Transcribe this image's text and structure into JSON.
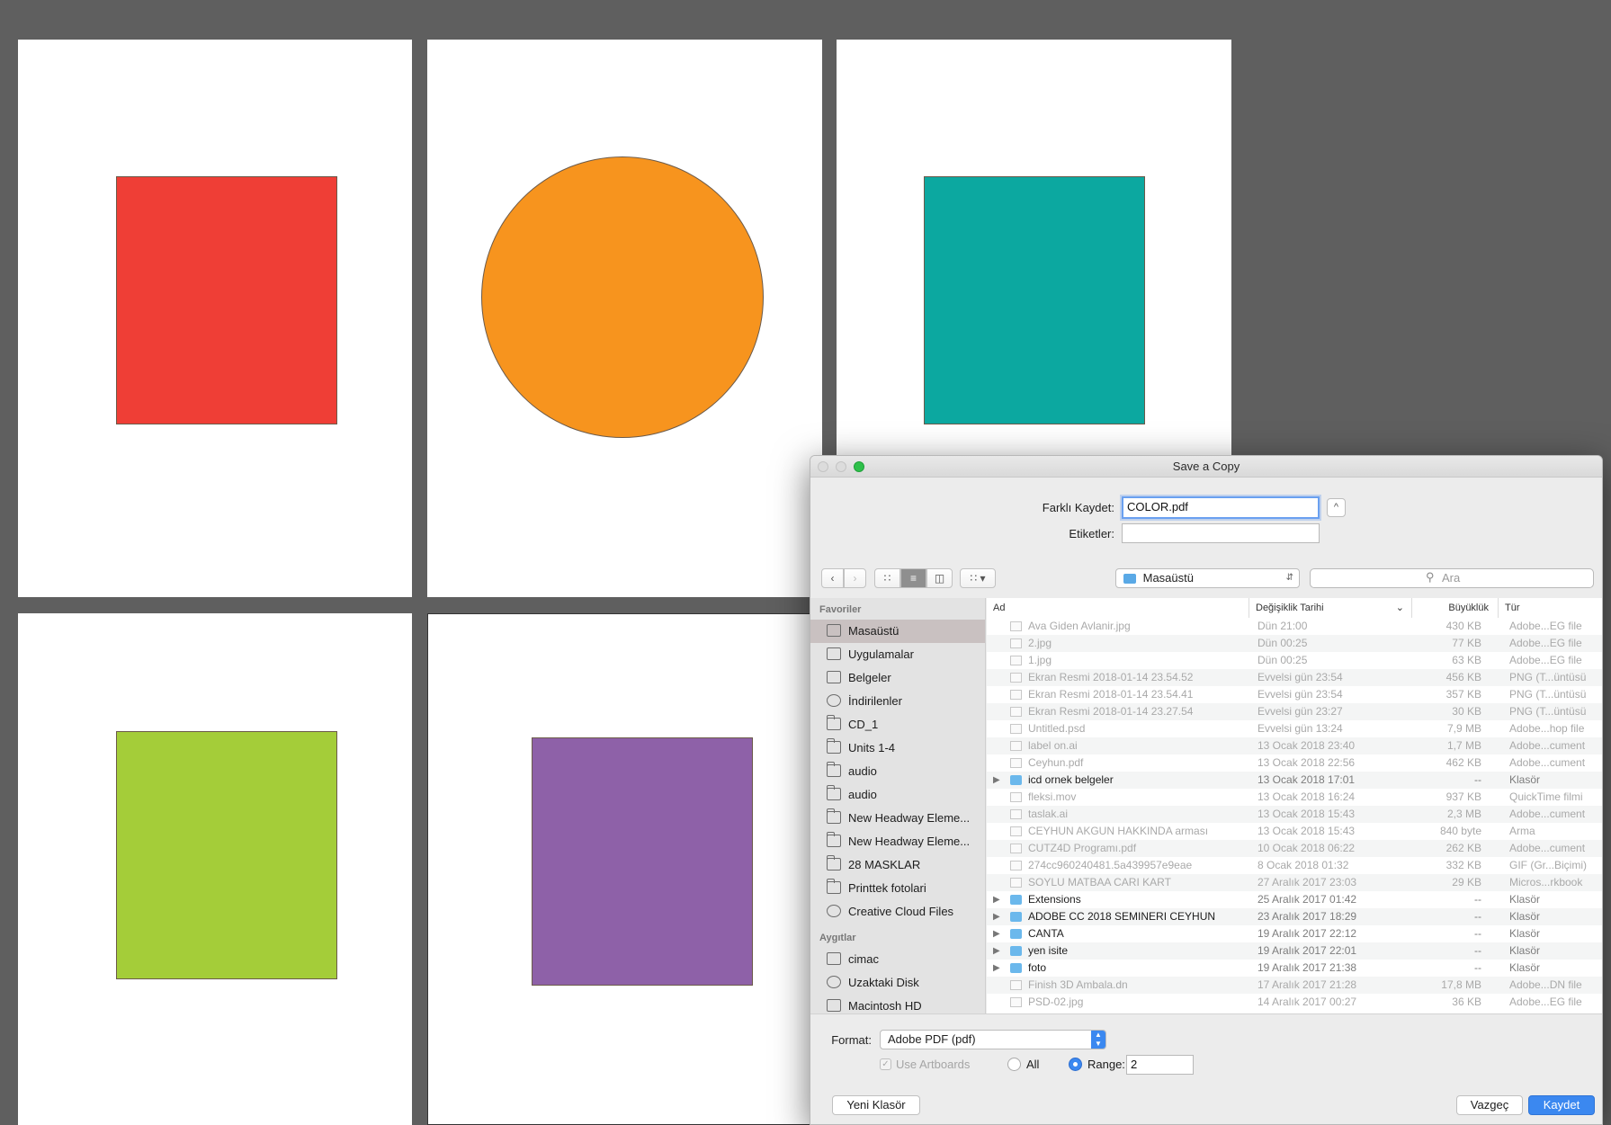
{
  "colors": {
    "red": "#ef3e36",
    "orange": "#f7941e",
    "teal": "#0ca8a0",
    "green": "#a4cd39",
    "purple": "#8e61a8",
    "accent": "#3b88f0"
  },
  "dialog": {
    "title": "Save a Copy",
    "save_as_label": "Farklı Kaydet:",
    "save_as_value": "COLOR.pdf",
    "tags_label": "Etiketler:",
    "location": "Masaüstü",
    "search_placeholder": "Ara",
    "expand_symbol": "^"
  },
  "sidebar": {
    "favorites_header": "Favoriler",
    "devices_header": "Aygıtlar",
    "favorites": [
      {
        "label": "Masaüstü",
        "icon": "desktop-icon",
        "selected": true
      },
      {
        "label": "Uygulamalar",
        "icon": "applications-icon"
      },
      {
        "label": "Belgeler",
        "icon": "documents-icon"
      },
      {
        "label": "İndirilenler",
        "icon": "downloads-icon"
      },
      {
        "label": "CD_1",
        "icon": "folder-icon"
      },
      {
        "label": "Units 1-4",
        "icon": "folder-icon"
      },
      {
        "label": "audio",
        "icon": "folder-icon"
      },
      {
        "label": "audio",
        "icon": "folder-icon"
      },
      {
        "label": "New Headway Eleme...",
        "icon": "folder-icon"
      },
      {
        "label": "New Headway Eleme...",
        "icon": "folder-icon"
      },
      {
        "label": "28  MASKLAR",
        "icon": "folder-icon"
      },
      {
        "label": "Printtek fotolari",
        "icon": "folder-icon"
      },
      {
        "label": "Creative Cloud Files",
        "icon": "creative-cloud-icon"
      }
    ],
    "devices": [
      {
        "label": "cimac",
        "icon": "computer-icon"
      },
      {
        "label": "Uzaktaki Disk",
        "icon": "remote-disk-icon"
      },
      {
        "label": "Macintosh HD",
        "icon": "hard-disk-icon"
      }
    ]
  },
  "columns": {
    "name": "Ad",
    "date": "Değişiklik Tarihi",
    "size": "Büyüklük",
    "kind": "Tür"
  },
  "files": [
    {
      "name": "Ava Giden Avlanir.jpg",
      "date": "Dün 21:00",
      "size": "430 KB",
      "kind": "Adobe...EG file",
      "dim": true,
      "folder": false
    },
    {
      "name": "2.jpg",
      "date": "Dün 00:25",
      "size": "77 KB",
      "kind": "Adobe...EG file",
      "dim": true,
      "folder": false
    },
    {
      "name": "1.jpg",
      "date": "Dün 00:25",
      "size": "63 KB",
      "kind": "Adobe...EG file",
      "dim": true,
      "folder": false
    },
    {
      "name": "Ekran Resmi 2018-01-14 23.54.52",
      "date": "Evvelsi gün 23:54",
      "size": "456 KB",
      "kind": "PNG (T...üntüsü",
      "dim": true,
      "folder": false
    },
    {
      "name": "Ekran Resmi 2018-01-14 23.54.41",
      "date": "Evvelsi gün 23:54",
      "size": "357 KB",
      "kind": "PNG (T...üntüsü",
      "dim": true,
      "folder": false
    },
    {
      "name": "Ekran Resmi 2018-01-14 23.27.54",
      "date": "Evvelsi gün 23:27",
      "size": "30 KB",
      "kind": "PNG (T...üntüsü",
      "dim": true,
      "folder": false
    },
    {
      "name": "Untitled.psd",
      "date": "Evvelsi gün 13:24",
      "size": "7,9 MB",
      "kind": "Adobe...hop file",
      "dim": true,
      "folder": false
    },
    {
      "name": "label on.ai",
      "date": "13 Ocak 2018 23:40",
      "size": "1,7 MB",
      "kind": "Adobe...cument",
      "dim": true,
      "folder": false
    },
    {
      "name": "Ceyhun.pdf",
      "date": "13 Ocak 2018 22:56",
      "size": "462 KB",
      "kind": "Adobe...cument",
      "dim": true,
      "folder": false
    },
    {
      "name": "icd ornek belgeler",
      "date": "13 Ocak 2018 17:01",
      "size": "--",
      "kind": "Klasör",
      "dim": false,
      "folder": true
    },
    {
      "name": "fleksi.mov",
      "date": "13 Ocak 2018 16:24",
      "size": "937 KB",
      "kind": "QuickTime filmi",
      "dim": true,
      "folder": false
    },
    {
      "name": "taslak.ai",
      "date": "13 Ocak 2018 15:43",
      "size": "2,3 MB",
      "kind": "Adobe...cument",
      "dim": true,
      "folder": false
    },
    {
      "name": "CEYHUN AKGUN HAKKINDA arması",
      "date": "13 Ocak 2018 15:43",
      "size": "840 byte",
      "kind": "Arma",
      "dim": true,
      "folder": false
    },
    {
      "name": "CUTZ4D Programı.pdf",
      "date": "10 Ocak 2018 06:22",
      "size": "262 KB",
      "kind": "Adobe...cument",
      "dim": true,
      "folder": false
    },
    {
      "name": "274cc960240481.5a439957e9eae",
      "date": "8 Ocak 2018 01:32",
      "size": "332 KB",
      "kind": "GIF (Gr...Biçimi)",
      "dim": true,
      "folder": false
    },
    {
      "name": "SOYLU MATBAA CARI KART",
      "date": "27 Aralık 2017 23:03",
      "size": "29 KB",
      "kind": "Micros...rkbook",
      "dim": true,
      "folder": false
    },
    {
      "name": "Extensions",
      "date": "25 Aralık 2017 01:42",
      "size": "--",
      "kind": "Klasör",
      "dim": false,
      "folder": true
    },
    {
      "name": "ADOBE CC 2018 SEMINERI CEYHUN",
      "date": "23 Aralık 2017 18:29",
      "size": "--",
      "kind": "Klasör",
      "dim": false,
      "folder": true
    },
    {
      "name": "CANTA",
      "date": "19 Aralık 2017 22:12",
      "size": "--",
      "kind": "Klasör",
      "dim": false,
      "folder": true
    },
    {
      "name": "yen isite",
      "date": "19 Aralık 2017 22:01",
      "size": "--",
      "kind": "Klasör",
      "dim": false,
      "folder": true
    },
    {
      "name": "foto",
      "date": "19 Aralık 2017 21:38",
      "size": "--",
      "kind": "Klasör",
      "dim": false,
      "folder": true
    },
    {
      "name": "Finish 3D Ambala.dn",
      "date": "17 Aralık 2017 21:28",
      "size": "17,8 MB",
      "kind": "Adobe...DN file",
      "dim": true,
      "folder": false
    },
    {
      "name": "PSD-02.jpg",
      "date": "14 Aralık 2017 00:27",
      "size": "36 KB",
      "kind": "Adobe...EG file",
      "dim": true,
      "folder": false
    }
  ],
  "options": {
    "format_label": "Format:",
    "format_value": "Adobe PDF (pdf)",
    "use_artboards": "Use Artboards",
    "all_label": "All",
    "range_label": "Range:",
    "range_value": "2"
  },
  "buttons": {
    "new_folder": "Yeni Klasör",
    "cancel": "Vazgeç",
    "save": "Kaydet"
  }
}
